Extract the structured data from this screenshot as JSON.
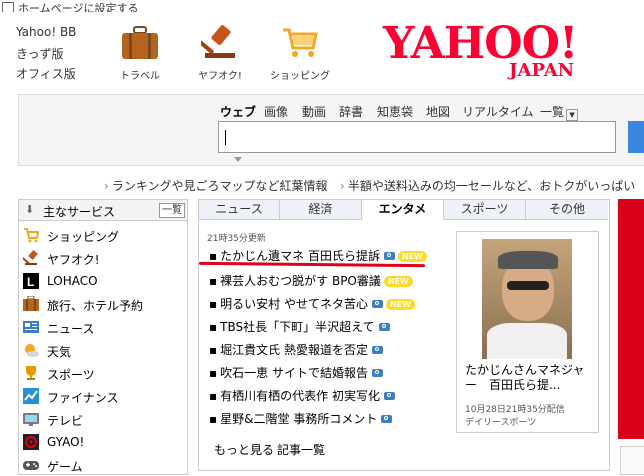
{
  "top_strip": {
    "text": "ホームページに設定する"
  },
  "left_links": [
    "Yahoo! BB",
    "きっず版",
    "オフィス版"
  ],
  "services": [
    {
      "label": "トラベル",
      "icon": "suitcase-icon"
    },
    {
      "label": "ヤフオク!",
      "icon": "gavel-icon"
    },
    {
      "label": "ショッピング",
      "icon": "cart-icon"
    }
  ],
  "logo": {
    "main": "YAHOO!",
    "sub": "JAPAN"
  },
  "search": {
    "tabs": [
      "ウェブ",
      "画像",
      "動画",
      "辞書",
      "知恵袋",
      "地図",
      "リアルタイム",
      "一覧"
    ],
    "active_tab": "ウェブ",
    "value": ""
  },
  "promos": [
    "ランキングや見ごろマップなど紅葉情報",
    "半額や送料込みの均一セールなど、おトクがいっぱい"
  ],
  "main_services": {
    "title": "主なサービス",
    "list_button": "一覧",
    "items": [
      {
        "label": "ショッピング",
        "icon": "cart-icon",
        "color": "#f5a623"
      },
      {
        "label": "ヤフオク!",
        "icon": "gavel-icon",
        "color": "#c8551d"
      },
      {
        "label": "LOHACO",
        "icon": "lohaco-icon",
        "color": "#000000"
      },
      {
        "label": "旅行、ホテル予約",
        "icon": "suitcase-icon",
        "color": "#b5651d"
      },
      {
        "label": "ニュース",
        "icon": "news-icon",
        "color": "#3a7dc9"
      },
      {
        "label": "天気",
        "icon": "weather-icon",
        "color": "#f5a623"
      },
      {
        "label": "スポーツ",
        "icon": "trophy-icon",
        "color": "#e59b00"
      },
      {
        "label": "ファイナンス",
        "icon": "chart-icon",
        "color": "#2a8fd6"
      },
      {
        "label": "テレビ",
        "icon": "tv-icon",
        "color": "#7a7a7a"
      },
      {
        "label": "GYAO!",
        "icon": "gyao-icon",
        "color": "#e0001a"
      },
      {
        "label": "ゲーム",
        "icon": "game-icon",
        "color": "#555555"
      }
    ]
  },
  "news": {
    "tabs": [
      "ニュース",
      "経済",
      "エンタメ",
      "スポーツ",
      "その他"
    ],
    "active_tab": "エンタメ",
    "updated": "21時35分更新",
    "headlines": [
      {
        "text": "たかじん遺マネ 百田氏ら提訴",
        "camera": true,
        "new": true,
        "new_label": "NEW"
      },
      {
        "text": "裸芸人おむつ脱がす BPO審議",
        "camera": false,
        "new": true,
        "new_label": "NEW"
      },
      {
        "text": "明るい安村 やせてネタ苦心",
        "camera": true,
        "new": true,
        "new_label": "NEW"
      },
      {
        "text": "TBS社長「下町」半沢超えて",
        "camera": true,
        "new": false,
        "new_label": ""
      },
      {
        "text": "堀江貴文氏 熱愛報道を否定",
        "camera": true,
        "new": false,
        "new_label": ""
      },
      {
        "text": "吹石一恵 サイトで結婚報告",
        "camera": true,
        "new": false,
        "new_label": ""
      },
      {
        "text": "有栖川有栖の代表作 初実写化",
        "camera": true,
        "new": false,
        "new_label": ""
      },
      {
        "text": "星野&二階堂 事務所コメント",
        "camera": true,
        "new": false,
        "new_label": ""
      }
    ],
    "more_link": "もっと見る",
    "list_link": "記事一覧",
    "photo": {
      "caption": "たかじんさんマネジャー　百田氏ら提...",
      "date": "10月28日21時35分配信",
      "source": "デイリースポーツ"
    }
  },
  "colors": {
    "accent": "#ff0033",
    "link": "#1a0dab",
    "underline": "#e0001a",
    "new_badge": "#ffd92e"
  }
}
